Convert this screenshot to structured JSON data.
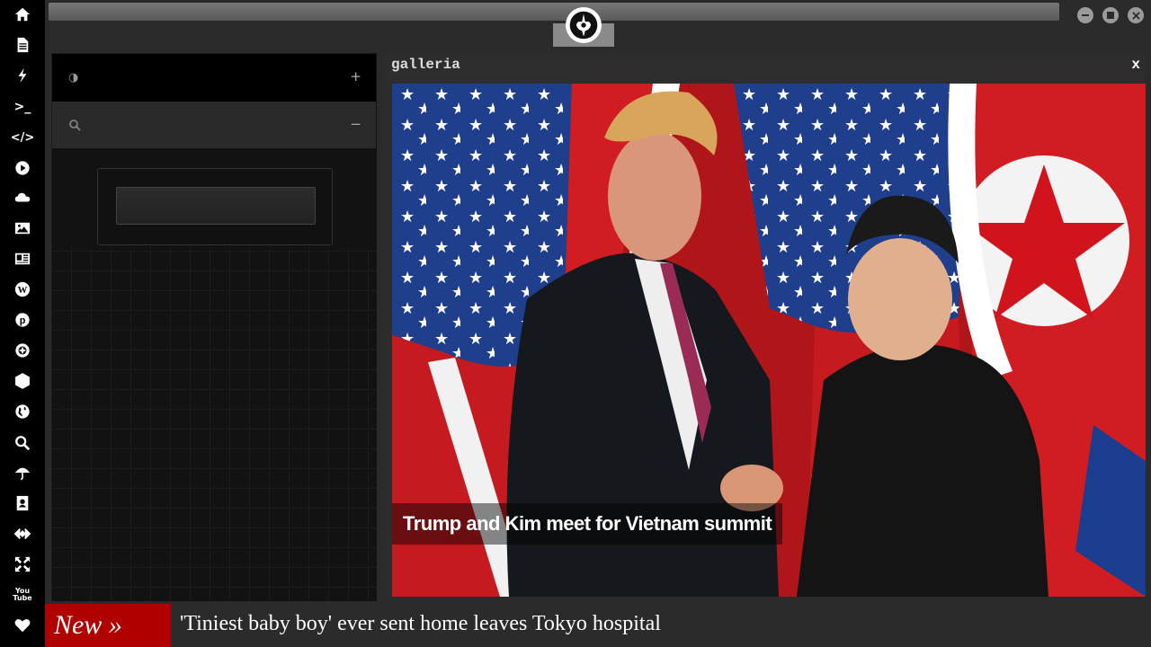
{
  "dock": {
    "icons": [
      "home-icon",
      "document-icon",
      "lightning-icon",
      "terminal-icon",
      "code-icon",
      "play-icon",
      "cloud-icon",
      "image-icon",
      "newspaper-icon",
      "wordpress-icon",
      "pinterest-icon",
      "aperture-icon",
      "network-icon",
      "globe-icon",
      "search-icon",
      "umbrella-icon",
      "contacts-icon",
      "api-icon",
      "fullscreen-icon",
      "youtube-icon",
      "heart-icon"
    ],
    "terminal_glyph": ">_",
    "code_glyph": "</>",
    "youtube_glyph": "You Tube"
  },
  "panel": {
    "header_expand": "+",
    "search_collapse": "−",
    "search_value": ""
  },
  "gallery": {
    "title": "galleria",
    "close_label": "x",
    "caption": "Trump and Kim meet for Vietnam summit"
  },
  "ticker": {
    "badge": "New »",
    "headline": "'Tiniest baby boy' ever sent home leaves Tokyo hospital"
  },
  "colors": {
    "dock_bg": "#000000",
    "ticker_badge": "#b00000",
    "app_bg": "#2b2b2b"
  }
}
